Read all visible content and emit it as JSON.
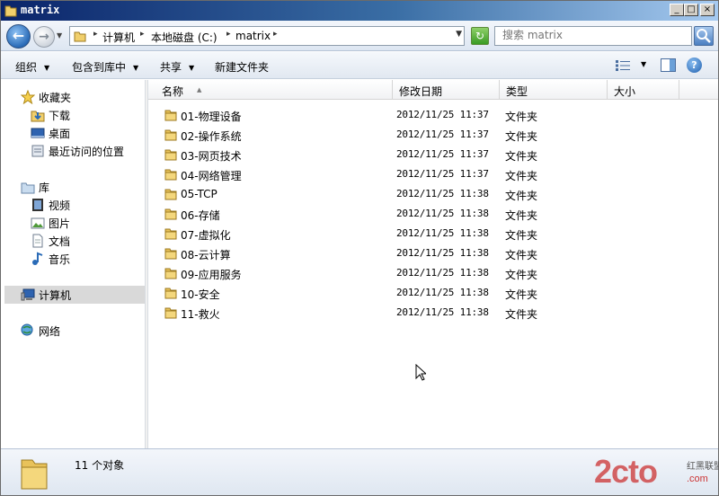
{
  "window": {
    "title": "matrix",
    "controls": {
      "minimize": "_",
      "maximize": "□",
      "close": "×"
    }
  },
  "address": {
    "crumbs": [
      "计算机",
      "本地磁盘 (C:)",
      "matrix"
    ],
    "search_placeholder": "搜索 matrix"
  },
  "toolbar": {
    "organize": "组织",
    "include_in_library": "包含到库中",
    "share": "共享",
    "new_folder": "新建文件夹"
  },
  "nav": {
    "favorites": {
      "label": "收藏夹",
      "items": [
        "下载",
        "桌面",
        "最近访问的位置"
      ]
    },
    "libraries": {
      "label": "库",
      "items": [
        "视频",
        "图片",
        "文档",
        "音乐"
      ]
    },
    "computer": "计算机",
    "network": "网络"
  },
  "columns": {
    "name": "名称",
    "modified": "修改日期",
    "type": "类型",
    "size": "大小"
  },
  "files": [
    {
      "name": "01-物理设备",
      "modified": "2012/11/25 11:37",
      "type": "文件夹"
    },
    {
      "name": "02-操作系统",
      "modified": "2012/11/25 11:37",
      "type": "文件夹"
    },
    {
      "name": "03-网页技术",
      "modified": "2012/11/25 11:37",
      "type": "文件夹"
    },
    {
      "name": "04-网络管理",
      "modified": "2012/11/25 11:37",
      "type": "文件夹"
    },
    {
      "name": "05-TCP",
      "modified": "2012/11/25 11:38",
      "type": "文件夹"
    },
    {
      "name": "06-存储",
      "modified": "2012/11/25 11:38",
      "type": "文件夹"
    },
    {
      "name": "07-虚拟化",
      "modified": "2012/11/25 11:38",
      "type": "文件夹"
    },
    {
      "name": "08-云计算",
      "modified": "2012/11/25 11:38",
      "type": "文件夹"
    },
    {
      "name": "09-应用服务",
      "modified": "2012/11/25 11:38",
      "type": "文件夹"
    },
    {
      "name": "10-安全",
      "modified": "2012/11/25 11:38",
      "type": "文件夹"
    },
    {
      "name": "11-救火",
      "modified": "2012/11/25 11:38",
      "type": "文件夹"
    }
  ],
  "status": {
    "count": "11 个对象"
  },
  "watermark": {
    "logo": "2cto",
    "line1": "红黑联盟",
    "line2": ".com"
  },
  "colors": {
    "folder": "#e8c25a",
    "selection": "#d9d9d9",
    "title_start": "#0a246a",
    "title_end": "#a6caf0"
  }
}
